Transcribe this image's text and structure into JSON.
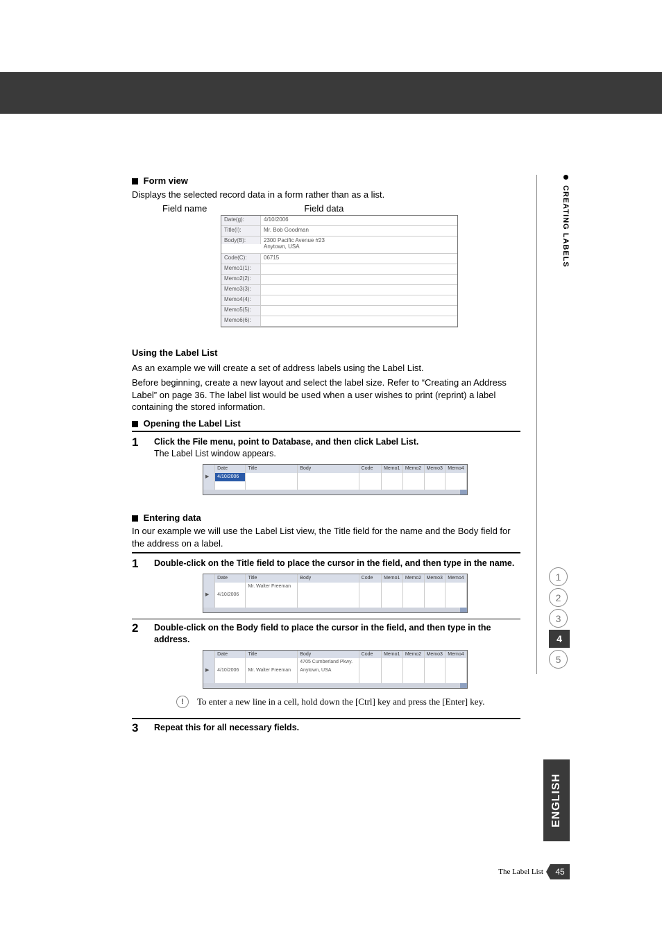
{
  "vertical_label": "CREATING LABELS",
  "form_view": {
    "heading": "Form view",
    "desc": "Displays the selected record data in a form rather than as a list.",
    "callouts": {
      "name": "Field name",
      "data": "Field data"
    },
    "rows": [
      {
        "label": "Date(g):",
        "value": "4/10/2006"
      },
      {
        "label": "Title(I):",
        "value": "Mr. Bob Goodman"
      },
      {
        "label": "Body(B):",
        "value": "2300 Pacific Avenue #23\nAnytown, USA"
      },
      {
        "label": "Code(C):",
        "value": "06715"
      },
      {
        "label": "Memo1(1):",
        "value": ""
      },
      {
        "label": "Memo2(2):",
        "value": ""
      },
      {
        "label": "Memo3(3):",
        "value": ""
      },
      {
        "label": "Memo4(4):",
        "value": ""
      },
      {
        "label": "Memo5(5):",
        "value": ""
      },
      {
        "label": "Memo6(6):",
        "value": ""
      }
    ]
  },
  "using": {
    "heading": "Using the Label List",
    "p1": "As an example we will create a set of address labels using the Label List.",
    "p2": "Before beginning, create a new layout and select the label size. Refer to “Creating an Address Label” on page 36. The label list would be used when a user wishes to print (reprint) a label containing the stored information."
  },
  "opening": {
    "heading": "Opening the Label List",
    "step1_bold": "Click the File menu, point to Database, and then click Label List.",
    "step1_sub": "The Label List window appears."
  },
  "listgrid": {
    "headers": [
      "Date",
      "Title",
      "Body",
      "Code",
      "Memo1",
      "Memo2",
      "Memo3",
      "Memo4"
    ],
    "row1": {
      "date": "4/10/2006",
      "title_step1": "Mr. Walter Freeman",
      "body_step2a": "4705 Cumberland Pkwy.",
      "body_step2b": "Anytown, USA"
    }
  },
  "entering": {
    "heading": "Entering data",
    "intro": "In our example we will use the Label List view, the Title field for the name and the Body field for the address on a label.",
    "step1": "Double-click on the Title field to place the cursor in the field, and then type in the name.",
    "step2": "Double-click on the Body field to place the cursor in the field, and then type in the address.",
    "note": "To enter a new line in a cell, hold down the [Ctrl] key and press the [Enter] key.",
    "step3": "Repeat this for all necessary fields."
  },
  "side_tabs": [
    "1",
    "2",
    "3",
    "4",
    "5"
  ],
  "english": "ENGLISH",
  "footer": {
    "text": "The Label List",
    "page": "45"
  }
}
